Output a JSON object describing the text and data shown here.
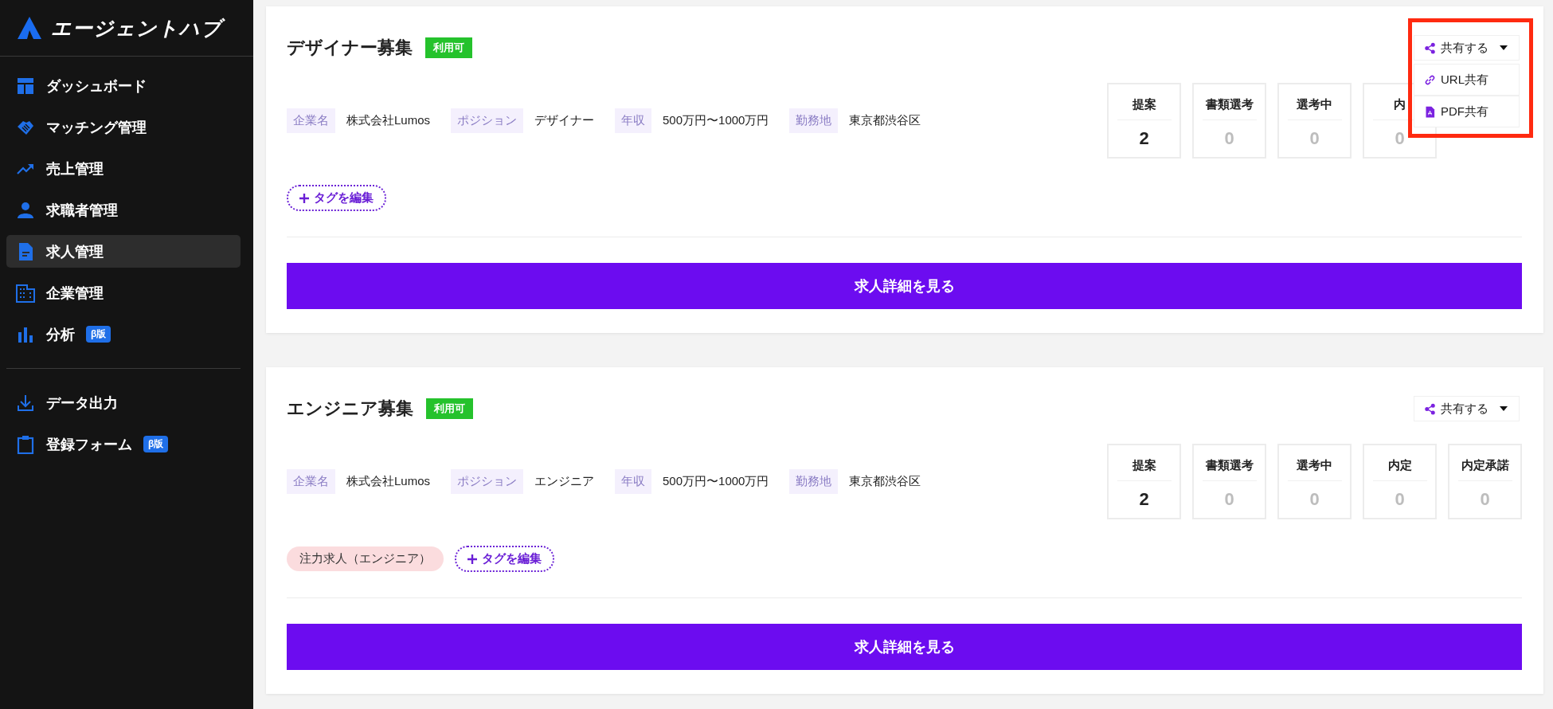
{
  "sidebar": {
    "logo": "エージェントハブ",
    "sections": [
      {
        "items": [
          {
            "label": "ダッシュボード",
            "selected": false
          },
          {
            "label": "マッチング管理",
            "selected": false
          },
          {
            "label": "売上管理",
            "selected": false
          },
          {
            "label": "求職者管理",
            "selected": false
          },
          {
            "label": "求人管理",
            "selected": true
          },
          {
            "label": "企業管理",
            "selected": false
          },
          {
            "label": "分析",
            "selected": false,
            "badge": "β版"
          }
        ]
      },
      {
        "items": [
          {
            "label": "データ出力",
            "selected": false
          },
          {
            "label": "登録フォーム",
            "selected": false,
            "badge": "β版"
          }
        ]
      }
    ]
  },
  "jobs": [
    {
      "title": "デザイナー募集",
      "status": "利用可",
      "share": {
        "label": "共有する",
        "expanded": true,
        "highlighted": true,
        "menu": [
          {
            "label": "URL共有"
          },
          {
            "label": "PDF共有"
          }
        ]
      },
      "fields": [
        {
          "label": "企業名",
          "value": "株式会社Lumos"
        },
        {
          "label": "ポジション",
          "value": "デザイナー"
        },
        {
          "label": "年収",
          "value": "500万円〜1000万円"
        },
        {
          "label": "勤務地",
          "value": "東京都渋谷区"
        }
      ],
      "stats": [
        {
          "label": "提案",
          "value": "2",
          "dim": false
        },
        {
          "label": "書類選考",
          "value": "0",
          "dim": true
        },
        {
          "label": "選考中",
          "value": "0",
          "dim": true
        },
        {
          "label": "内",
          "value": "0",
          "dim": true
        }
      ],
      "edit_tags": "タグを編集",
      "action": "求人詳細を見る"
    },
    {
      "title": "エンジニア募集",
      "status": "利用可",
      "share": {
        "label": "共有する"
      },
      "fields": [
        {
          "label": "企業名",
          "value": "株式会社Lumos"
        },
        {
          "label": "ポジション",
          "value": "エンジニア"
        },
        {
          "label": "年収",
          "value": "500万円〜1000万円"
        },
        {
          "label": "勤務地",
          "value": "東京都渋谷区"
        }
      ],
      "stats": [
        {
          "label": "提案",
          "value": "2",
          "dim": false
        },
        {
          "label": "書類選考",
          "value": "0",
          "dim": true
        },
        {
          "label": "選考中",
          "value": "0",
          "dim": true
        },
        {
          "label": "内定",
          "value": "0",
          "dim": true
        },
        {
          "label": "内定承諾",
          "value": "0",
          "dim": true
        }
      ],
      "tags": [
        "注力求人（エンジニア）"
      ],
      "edit_tags": "タグを編集",
      "action": "求人詳細を見る"
    }
  ]
}
